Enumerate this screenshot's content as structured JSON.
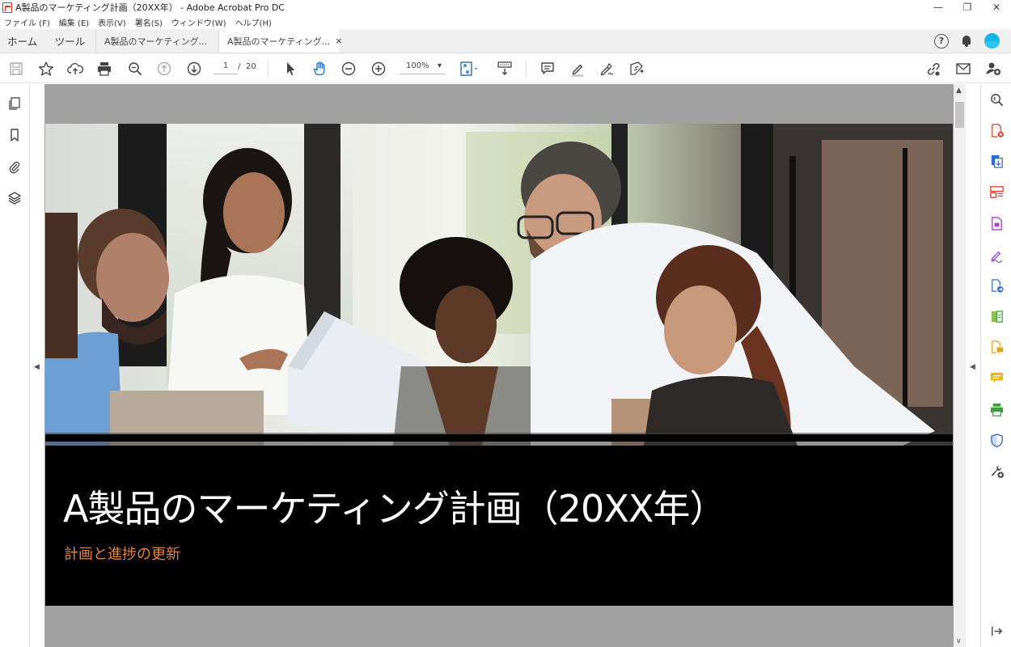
{
  "window": {
    "title": "A製品のマーケティング計画（20XX年） - Adobe Acrobat Pro DC",
    "controls": {
      "minimize": "—",
      "restore": "❐",
      "close": "✕"
    }
  },
  "menu": [
    "ファイル (F)",
    "編集 (E)",
    "表示(V)",
    "署名(S)",
    "ウィンドウ(W)",
    "ヘルプ(H)"
  ],
  "tabs": {
    "home": "ホーム",
    "tools": "ツール",
    "doc1": "A製品のマーケティング...",
    "doc2": "A製品のマーケティング...",
    "close": "×"
  },
  "toolbar": {
    "current_page": "1",
    "page_sep": "/",
    "total_pages": "20",
    "zoom": "100%",
    "zoom_caret": "▾"
  },
  "document": {
    "title": "A製品のマーケティング計画（20XX年）",
    "subtitle": "計画と進捗の更新"
  },
  "panels": {
    "left_arrow": "◀",
    "right_arrow": "◀",
    "scroll_up": "▲",
    "scroll_down": "∨"
  },
  "colors": {
    "subtitle": "#e8833a",
    "doc_background": "#a0a0a0",
    "avatar": "#1ab3e8"
  }
}
